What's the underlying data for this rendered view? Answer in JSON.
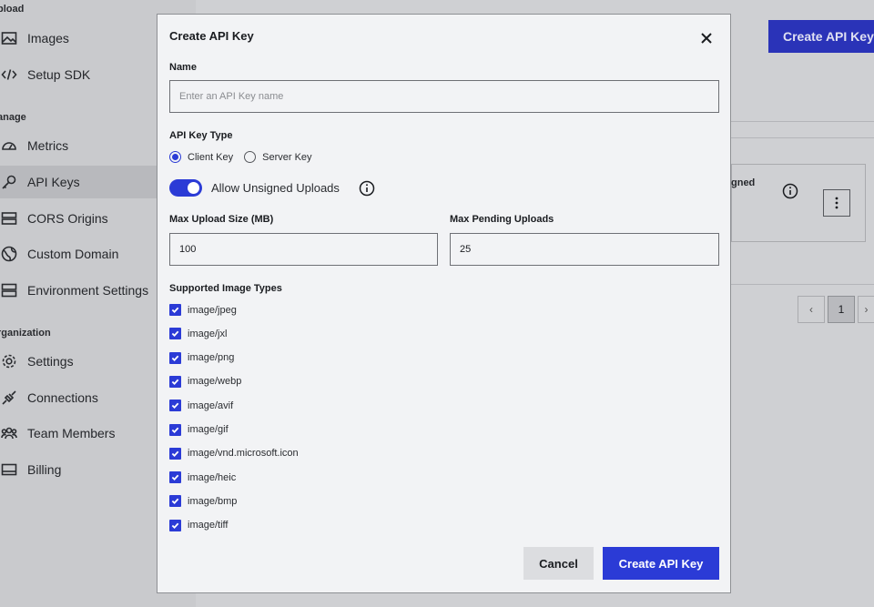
{
  "sidebar": {
    "sections": [
      {
        "label": "pload"
      },
      {
        "label": "anage"
      },
      {
        "label": "rganization"
      }
    ],
    "items": [
      {
        "label": "Images",
        "icon": "image-icon"
      },
      {
        "label": "Setup SDK",
        "icon": "code-icon"
      },
      {
        "label": "Metrics",
        "icon": "gauge-icon"
      },
      {
        "label": "API Keys",
        "icon": "key-icon"
      },
      {
        "label": "CORS Origins",
        "icon": "stack-icon"
      },
      {
        "label": "Custom Domain",
        "icon": "globe-icon"
      },
      {
        "label": "Environment Settings",
        "icon": "server-icon"
      },
      {
        "label": "Settings",
        "icon": "gear-icon"
      },
      {
        "label": "Connections",
        "icon": "plug-icon"
      },
      {
        "label": "Team Members",
        "icon": "users-icon"
      },
      {
        "label": "Billing",
        "icon": "card-icon"
      }
    ]
  },
  "background": {
    "create_button": "Create API Key",
    "card_text": "gned",
    "pager_current": "1"
  },
  "modal": {
    "title": "Create API Key",
    "name_label": "Name",
    "name_placeholder": "Enter an API Key name",
    "name_value": "",
    "type_label": "API Key Type",
    "type_options": [
      "Client Key",
      "Server Key"
    ],
    "type_selected": "Client Key",
    "toggle_label": "Allow Unsigned Uploads",
    "toggle_on": true,
    "max_size_label": "Max Upload Size (MB)",
    "max_size_value": "100",
    "max_pending_label": "Max Pending Uploads",
    "max_pending_value": "25",
    "types_label": "Supported Image Types",
    "image_types": [
      "image/jpeg",
      "image/jxl",
      "image/png",
      "image/webp",
      "image/avif",
      "image/gif",
      "image/vnd.microsoft.icon",
      "image/heic",
      "image/bmp",
      "image/tiff"
    ],
    "cancel_label": "Cancel",
    "create_label": "Create API Key"
  },
  "colors": {
    "accent": "#2b3bd6",
    "modal_bg": "#f2f3f5"
  }
}
